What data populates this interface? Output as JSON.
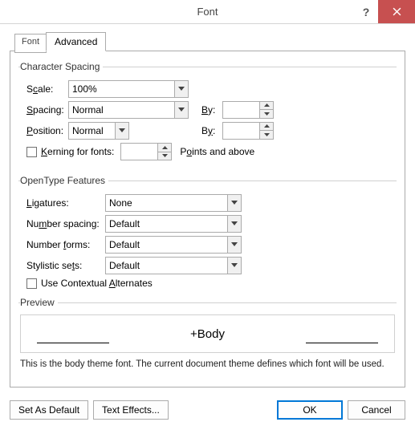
{
  "window": {
    "title": "Font"
  },
  "tabs": {
    "font": "Font",
    "advanced": "Advanced"
  },
  "charSpacing": {
    "legend": "Character Spacing",
    "scale_lbl": "Scale:",
    "scale_val": "100%",
    "spacing_lbl": "Spacing:",
    "spacing_val": "Normal",
    "by_lbl": "By:",
    "position_lbl": "Position:",
    "position_val": "Normal",
    "kerning_lbl": "Kerning for fonts:",
    "points_lbl": "Points and above"
  },
  "openType": {
    "legend": "OpenType Features",
    "ligatures_lbl": "Ligatures:",
    "ligatures_val": "None",
    "numspacing_lbl": "Number spacing:",
    "numspacing_val": "Default",
    "numforms_lbl": "Number forms:",
    "numforms_val": "Default",
    "stylistic_lbl": "Stylistic sets:",
    "stylistic_val": "Default",
    "contextual_lbl": "Use Contextual Alternates"
  },
  "preview": {
    "legend": "Preview",
    "sample": "+Body",
    "desc": "This is the body theme font. The current document theme defines which font will be used."
  },
  "footer": {
    "set_default": "Set As Default",
    "text_effects": "Text Effects...",
    "ok": "OK",
    "cancel": "Cancel"
  }
}
